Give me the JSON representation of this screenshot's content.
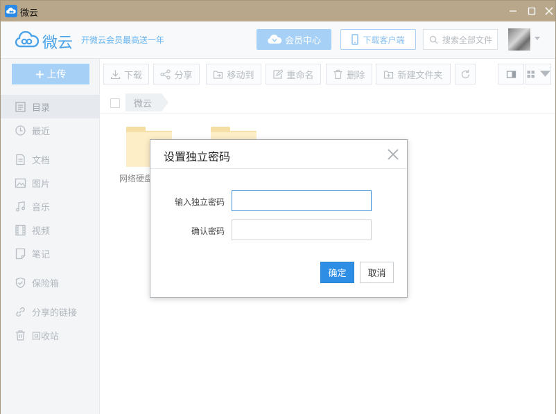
{
  "titlebar": {
    "title": "微云"
  },
  "header": {
    "logo_text": "微云",
    "promo": "开微云会员最高送一年",
    "vip_label": "会员中心",
    "download_label": "下载客户端",
    "search_placeholder": "搜索全部文件"
  },
  "sidebar": {
    "upload_label": "上传",
    "items": [
      {
        "label": "目录",
        "icon": "list-icon"
      },
      {
        "label": "最近",
        "icon": "clock-icon"
      },
      {
        "label": "文档",
        "icon": "document-icon"
      },
      {
        "label": "图片",
        "icon": "image-icon"
      },
      {
        "label": "音乐",
        "icon": "music-icon"
      },
      {
        "label": "视频",
        "icon": "film-icon"
      },
      {
        "label": "笔记",
        "icon": "note-icon"
      },
      {
        "label": "保险箱",
        "icon": "shield-icon"
      },
      {
        "label": "分享的链接",
        "icon": "link-icon"
      },
      {
        "label": "回收站",
        "icon": "trash-icon"
      }
    ]
  },
  "toolbar": {
    "download": "下载",
    "share": "分享",
    "move": "移动到",
    "rename": "重命名",
    "delete": "删除",
    "new_folder": "新建文件夹"
  },
  "breadcrumb": {
    "current": "微云"
  },
  "files": [
    {
      "name": "网络硬盘"
    },
    {
      "name": ""
    }
  ],
  "dialog": {
    "title": "设置独立密码",
    "password_label": "输入独立密码",
    "confirm_label": "确认密码",
    "password_value": "",
    "confirm_value": "",
    "ok_label": "确定",
    "cancel_label": "取消"
  },
  "colors": {
    "titlebar": "#b8a78b",
    "accent": "#2e8ee6",
    "accent_light": "#a6d0f5"
  }
}
